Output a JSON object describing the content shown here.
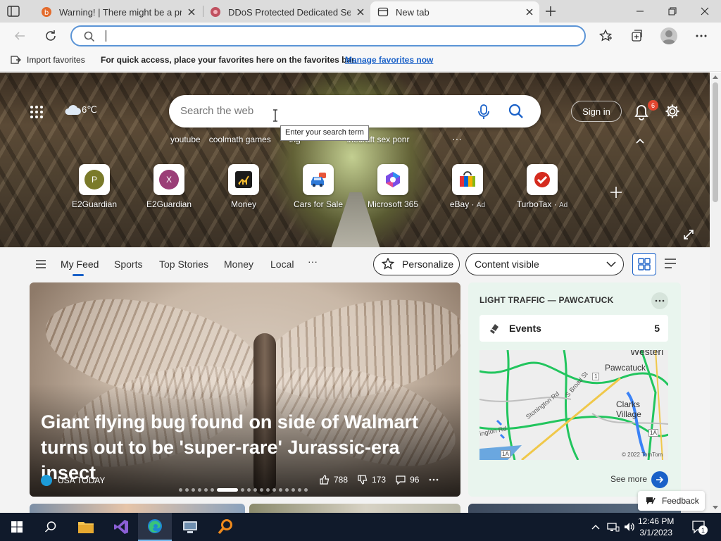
{
  "tabs": [
    {
      "title": "Warning! | There might be a prob",
      "icon": "warning-tab-favicon"
    },
    {
      "title": "DDoS Protected Dedicated Serve",
      "icon": "ddos-tab-favicon"
    },
    {
      "title": "New tab",
      "icon": "newtab-favicon",
      "active": true
    }
  ],
  "address": {
    "value": "",
    "placeholder": ""
  },
  "favorites_bar": {
    "import_label": "Import favorites",
    "message": "For quick access, place your favorites here on the favorites bar.",
    "manage_link": "Manage favorites now"
  },
  "hero": {
    "weather": "6℃",
    "search_placeholder": "Search the web",
    "tooltip": "Enter your search term",
    "trending": [
      "youtube",
      "coolmath games",
      "ing",
      "inecraft sex ponr"
    ],
    "trending_more": "···",
    "signin_label": "Sign in",
    "notification_count": "6",
    "tiles": [
      {
        "letter": "P",
        "name": "E2Guardian",
        "color": "#7a7a2a"
      },
      {
        "letter": "X",
        "name": "E2Guardian",
        "color": "#9b3e77"
      },
      {
        "name": "Money",
        "icon": "money-icon"
      },
      {
        "name": "Cars for Sale",
        "icon": "car-icon"
      },
      {
        "name": "Microsoft 365",
        "icon": "m365-icon"
      },
      {
        "name": "eBay",
        "ad": "Ad",
        "icon": "ebay-icon"
      },
      {
        "name": "TurboTax",
        "ad": "Ad",
        "icon": "turbotax-icon"
      }
    ]
  },
  "feed_nav": {
    "items": [
      "My Feed",
      "Sports",
      "Top Stories",
      "Money",
      "Local"
    ],
    "more": "···",
    "personalize_label": "Personalize",
    "content_select": "Content visible"
  },
  "hero_article": {
    "headline": "Giant flying bug found on side of Walmart turns out to be 'super-rare' Jurassic-era insect",
    "source": "USA TODAY",
    "likes": "788",
    "dislikes": "173",
    "comments": "96"
  },
  "traffic_card": {
    "title": "LIGHT TRAFFIC — PAWCATUCK",
    "events_label": "Events",
    "events_count": "5",
    "map_labels": [
      "Westerl",
      "Pawcatuck",
      "Clarks",
      "Village",
      "Stonington Rd",
      "S Broad St",
      "ington Rd",
      "1A",
      "1A",
      "1",
      "© 2022 TomTom"
    ],
    "see_more": "See more"
  },
  "feedback_label": "Feedback",
  "taskbar": {
    "time": "12:46 PM",
    "date": "3/1/2023",
    "notification_count": "1"
  }
}
